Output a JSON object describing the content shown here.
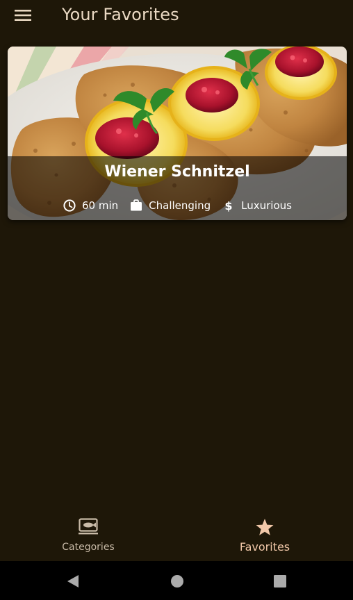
{
  "app_bar": {
    "title": "Your Favorites",
    "menu_icon": "menu-icon"
  },
  "meals": [
    {
      "title": "Wiener Schnitzel",
      "duration": "60 min",
      "complexity": "Challenging",
      "affordability": "Luxurious",
      "icons": {
        "duration": "clock-icon",
        "complexity": "briefcase-icon",
        "affordability": "dollar-icon"
      }
    }
  ],
  "bottom_nav": {
    "items": [
      {
        "label": "Categories",
        "icon": "set-meal-icon",
        "selected": false
      },
      {
        "label": "Favorites",
        "icon": "star-icon",
        "selected": true
      }
    ]
  },
  "system_nav": {
    "back_icon": "back-triangle-icon",
    "home_icon": "home-circle-icon",
    "recents_icon": "recents-square-icon"
  },
  "colors": {
    "background": "#1e1708",
    "title_text": "#ead9c3",
    "selected_nav": "#f2c8a9",
    "unselected_nav": "#c9bba8",
    "system_bar": "#000000"
  }
}
